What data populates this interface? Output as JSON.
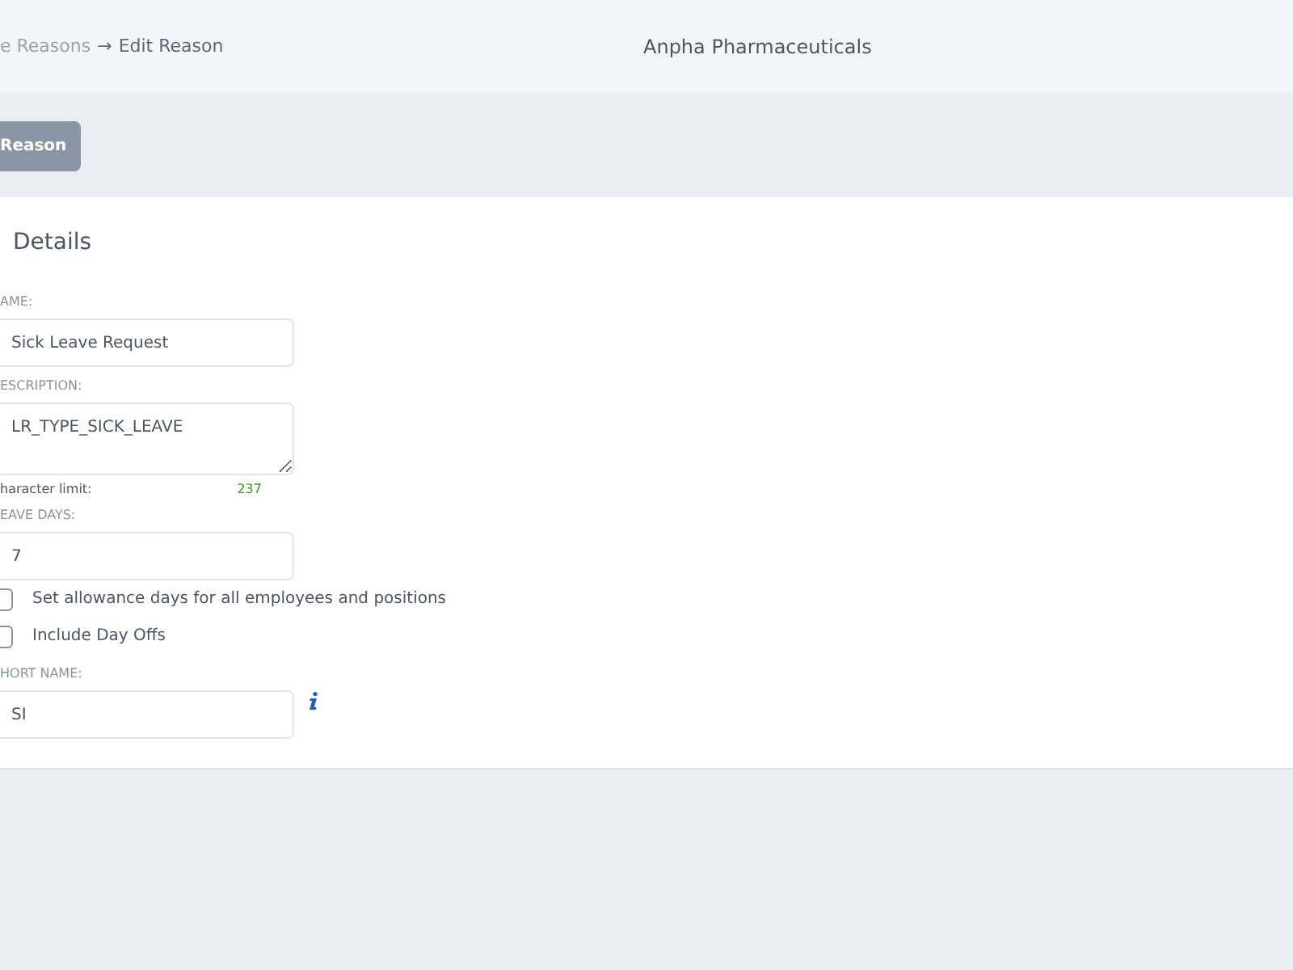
{
  "header": {
    "breadcrumb_parent": "e Reasons",
    "breadcrumb_separator": "→",
    "breadcrumb_current": "Edit Reason",
    "company": "Anpha Pharmaceuticals"
  },
  "toolbar": {
    "button": "Reason"
  },
  "card": {
    "title": "Details",
    "fields": [
      {
        "kind": "input",
        "label": "AME:",
        "value": "Sick Leave Request"
      },
      {
        "kind": "textarea",
        "label": "ESCRIPTION:",
        "value": "LR_TYPE_SICK_LEAVE",
        "hint_label": "haracter limit:",
        "hint_value": "237"
      },
      {
        "kind": "input",
        "label": "EAVE DAYS:",
        "value": "7"
      },
      {
        "kind": "checkbox",
        "label": "Set allowance days for all employees and positions",
        "checked": false
      },
      {
        "kind": "checkbox",
        "label": "Include Day Offs",
        "checked": false
      },
      {
        "kind": "input_info",
        "label": "HORT NAME:",
        "value": "SI"
      }
    ]
  }
}
